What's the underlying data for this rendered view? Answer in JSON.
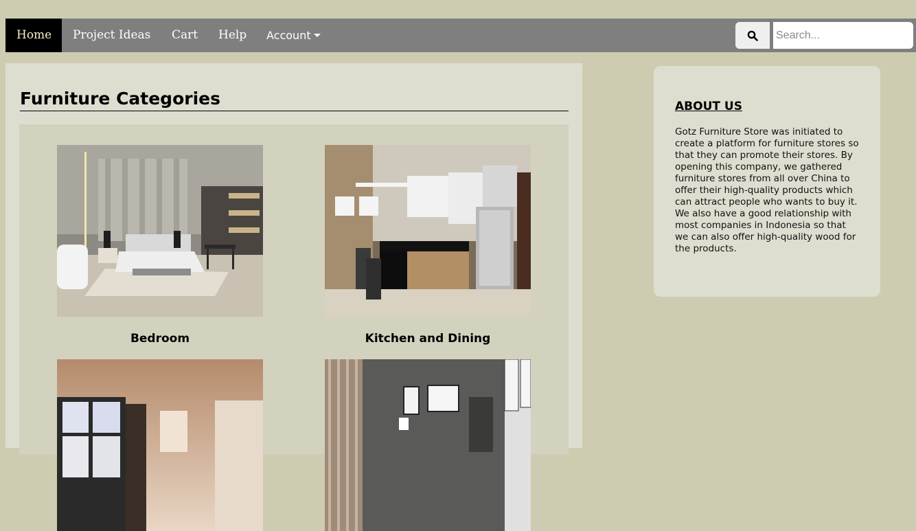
{
  "nav": {
    "items": [
      {
        "label": "Home",
        "active": true
      },
      {
        "label": "Project Ideas"
      },
      {
        "label": "Cart"
      },
      {
        "label": "Help"
      },
      {
        "label": "Account"
      }
    ]
  },
  "search": {
    "placeholder": "Search...",
    "value": "",
    "icon": "search-icon"
  },
  "categories": {
    "title": "Furniture Categories",
    "items": [
      {
        "label": "Bedroom"
      },
      {
        "label": "Kitchen and Dining"
      },
      {
        "label": ""
      },
      {
        "label": ""
      }
    ]
  },
  "about": {
    "title": "ABOUT US",
    "text": "Gotz Furniture Store was initiated to create a platform for furniture stores so that they can promote their stores. By opening this company, we gathered furniture stores from all over China to offer their high-quality products which can attract people who wants to buy it. We also have a good relationship with most companies in Indonesia so that we can also offer high-quality wood for the products."
  },
  "colors": {
    "page_bg": "#cdccb1",
    "nav_bg": "#7f7f7f",
    "nav_active_bg": "#000000",
    "panel_bg": "#deded0",
    "grid_bg": "#d3d2bf"
  }
}
